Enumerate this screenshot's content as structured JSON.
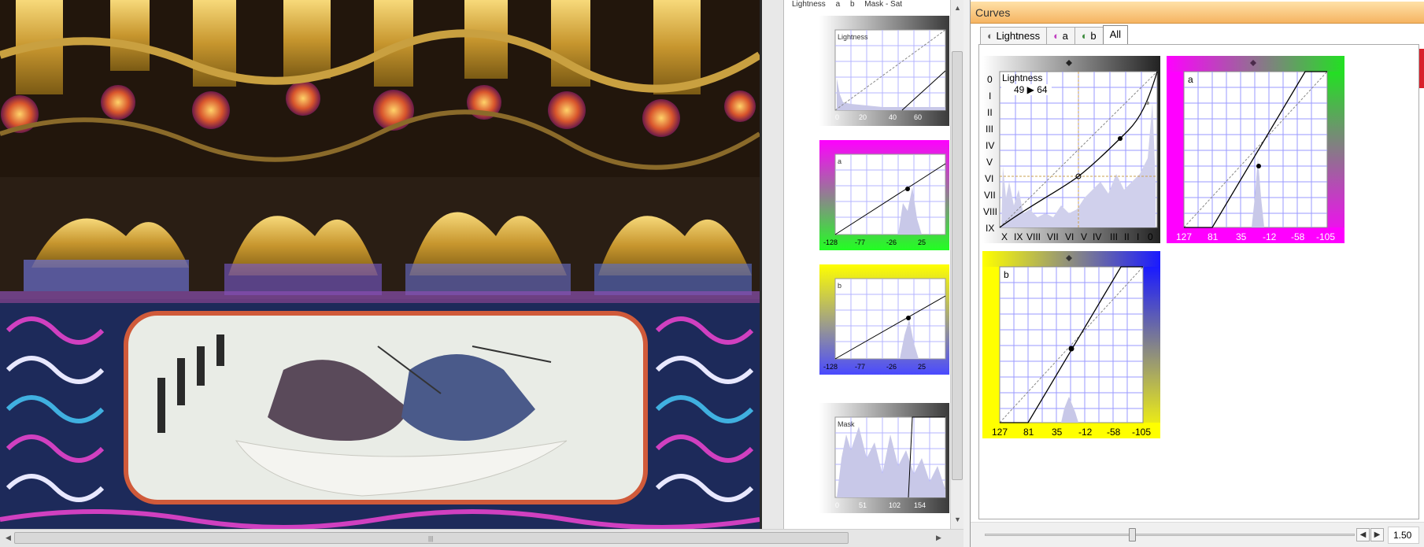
{
  "middle_panel": {
    "tabs": [
      "Lightness",
      "a",
      "b",
      "Mask - Sat"
    ],
    "graphs": [
      {
        "label": "Lightness",
        "ticks": [
          "0",
          "20",
          "40",
          "60"
        ],
        "color": "#7a7a7a"
      },
      {
        "label": "a",
        "ticks": [
          "-128",
          "-77",
          "-26",
          "25"
        ],
        "color": "#ff00ff"
      },
      {
        "label": "b",
        "ticks": [
          "-128",
          "-77",
          "-26",
          "25"
        ],
        "color": "#ffff00"
      },
      {
        "label": "Mask",
        "ticks": [
          "0",
          "51",
          "102",
          "154"
        ],
        "color": "#7a7a7a"
      }
    ]
  },
  "curves": {
    "title": "Curves",
    "tabs": [
      "Lightness",
      "a",
      "b",
      "All"
    ],
    "active_tab": "All",
    "lightness": {
      "label": "Lightness",
      "readout": "49 ▶ 64",
      "zones": [
        "0",
        "I",
        "II",
        "III",
        "IV",
        "V",
        "VI",
        "VII",
        "VIII",
        "IX",
        "X"
      ],
      "x_ticks": [
        "X",
        "IX",
        "VIII",
        "VII",
        "VI",
        "V",
        "IV",
        "III",
        "II",
        "I",
        "0"
      ]
    },
    "a": {
      "label": "a",
      "x_ticks": [
        "127",
        "81",
        "35",
        "-12",
        "-58",
        "-105"
      ]
    },
    "b": {
      "label": "b",
      "x_ticks": [
        "127",
        "81",
        "35",
        "-12",
        "-58",
        "-105"
      ]
    },
    "slider_value": "1.50"
  },
  "colors": {
    "accent_title": "#f5b462",
    "curve_grid": "#9a9aff",
    "magenta": "#ff00ff",
    "green": "#22dd22",
    "yellow": "#ffff00",
    "blue": "#1a1aff"
  }
}
